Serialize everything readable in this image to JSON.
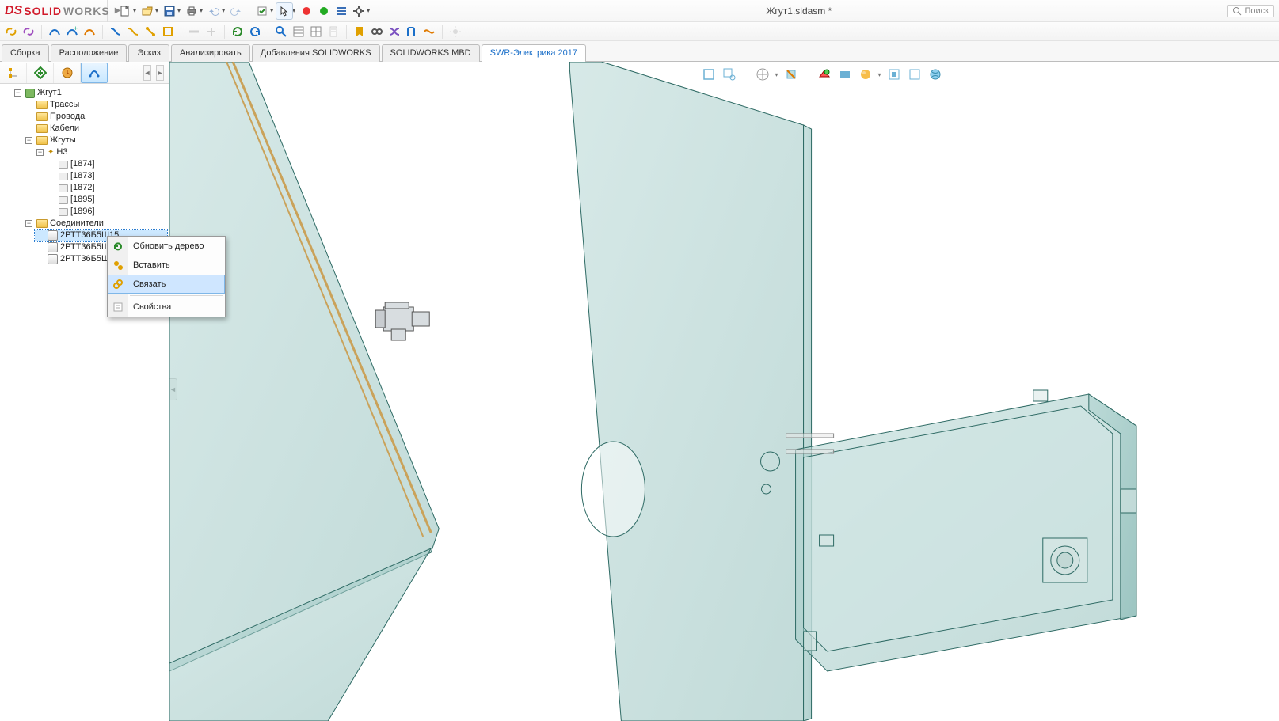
{
  "app": {
    "logo1": "SOLID",
    "logo2": "WORKS",
    "title": "Жгут1.sldasm *",
    "search": "Поиск"
  },
  "tabs": {
    "items": [
      "Сборка",
      "Расположение",
      "Эскиз",
      "Анализировать",
      "Добавления SOLIDWORKS",
      "SOLIDWORKS MBD",
      "SWR-Электрика 2017"
    ],
    "active_index": 6
  },
  "tree": {
    "root": "Жгут1",
    "f1": "Трассы",
    "f2": "Провода",
    "f3": "Кабели",
    "harnesses": "Жгуты",
    "h3": "Н3",
    "pins": [
      "[1874]",
      "[1873]",
      "[1872]",
      "[1895]",
      "[1896]"
    ],
    "connectors": "Соединители",
    "conn": [
      "2РТТ36Б5Ш15",
      "2РТТ36Б5Ш1",
      "2РТТ36Б5Ш1"
    ]
  },
  "ctx": {
    "i1": "Обновить дерево",
    "i2": "Вставить",
    "i3": "Связать",
    "i4": "Свойства",
    "highlight_index": 2
  },
  "colors": {
    "accent": "#1a6fc9"
  }
}
